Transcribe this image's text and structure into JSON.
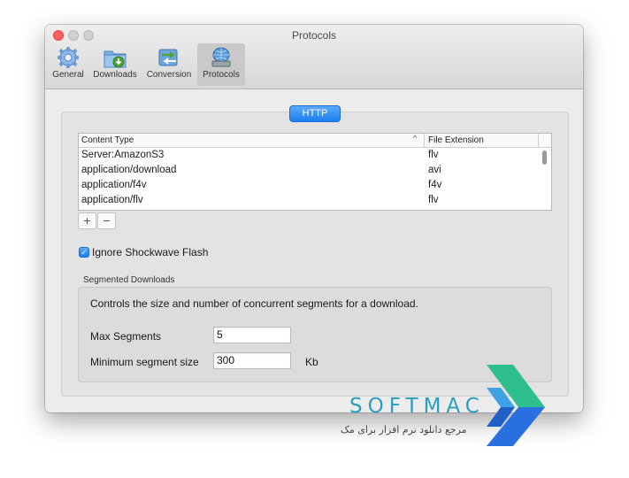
{
  "window": {
    "title": "Protocols"
  },
  "toolbar": {
    "items": [
      {
        "label": "General",
        "icon": "gear-icon"
      },
      {
        "label": "Downloads",
        "icon": "downloads-folder-icon"
      },
      {
        "label": "Conversion",
        "icon": "conversion-arrows-icon"
      },
      {
        "label": "Protocols",
        "icon": "network-drive-icon",
        "selected": true
      }
    ]
  },
  "tabs": {
    "active": "HTTP"
  },
  "table": {
    "columns": [
      "Content Type",
      "File Extension"
    ],
    "sorted_column": "Content Type",
    "sort_direction": "descending",
    "rows": [
      {
        "content_type": "Server:AmazonS3",
        "extension": "flv"
      },
      {
        "content_type": "application/download",
        "extension": "avi"
      },
      {
        "content_type": "application/f4v",
        "extension": "f4v"
      },
      {
        "content_type": "application/flv",
        "extension": "flv"
      }
    ]
  },
  "buttons": {
    "add": "+",
    "remove": "−"
  },
  "options": {
    "ignore_flash_label": "Ignore Shockwave Flash",
    "ignore_flash_checked": true
  },
  "segmented": {
    "section_title": "Segmented Downloads",
    "description": "Controls the size and number of concurrent segments for a download.",
    "max_segments_label": "Max Segments",
    "max_segments_value": "5",
    "min_size_label": "Minimum segment size",
    "min_size_value": "300",
    "min_size_unit": "Kb"
  },
  "watermark": {
    "brand": "SOFTMAC",
    "tagline": "مرجع دانلود نرم افزار برای مک"
  },
  "colors": {
    "accent": "#1b7ef0",
    "close": "#fc605c",
    "watermark": "#2a9ec0"
  }
}
